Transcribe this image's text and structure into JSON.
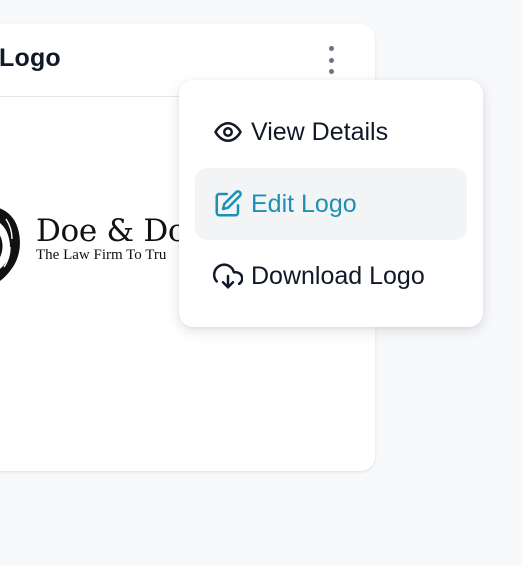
{
  "card": {
    "title": "Logo",
    "menu_icon": "kebab-vertical-icon",
    "logo": {
      "name": "Doe & Do",
      "tagline": "The Law Firm To Tru",
      "icon": "lion-head-icon"
    }
  },
  "menu": {
    "items": [
      {
        "label": "View Details",
        "icon": "eye-icon",
        "active": false
      },
      {
        "label": "Edit Logo",
        "icon": "edit-icon",
        "active": true
      },
      {
        "label": "Download Logo",
        "icon": "cloud-download-icon",
        "active": false
      }
    ]
  },
  "colors": {
    "background": "#f8f9fb",
    "accent": "#1e90b3",
    "active_bg": "#f3f4f6"
  }
}
